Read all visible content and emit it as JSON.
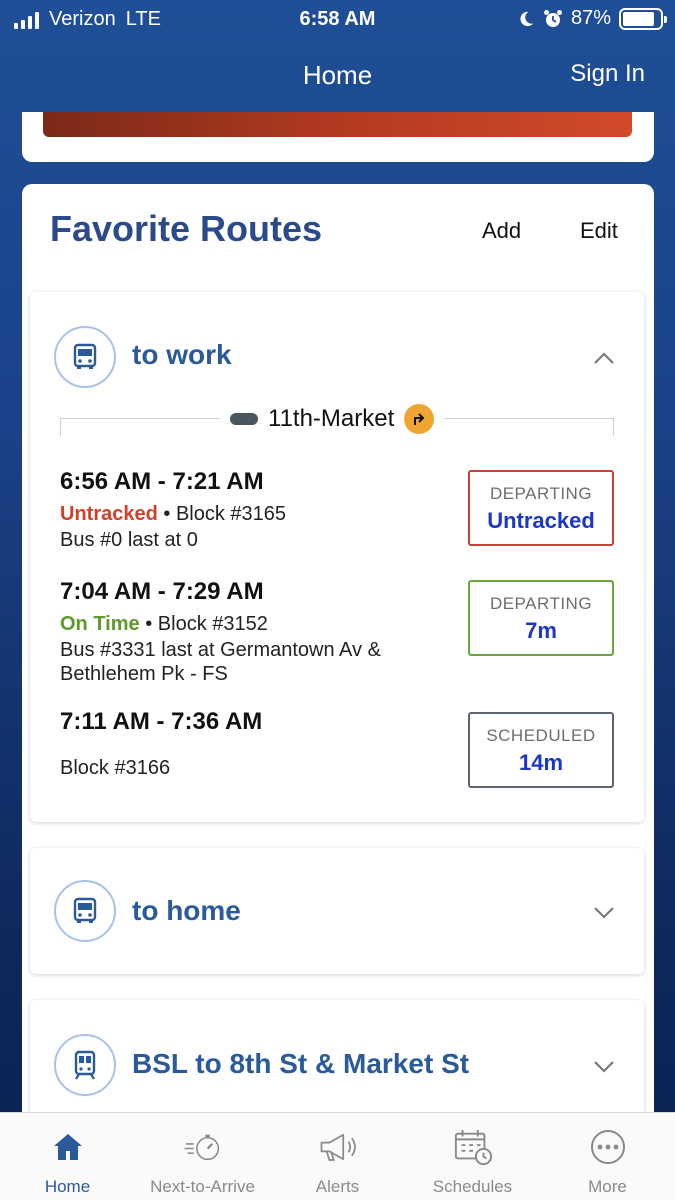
{
  "status_bar": {
    "carrier": "Verizon",
    "network": "LTE",
    "time": "6:58 AM",
    "battery": "87%",
    "battery_level": 0.87
  },
  "nav": {
    "title": "Home",
    "sign_in": "Sign In"
  },
  "favorites": {
    "title": "Favorite Routes",
    "add_label": "Add",
    "edit_label": "Edit",
    "routes": [
      {
        "name": "to work",
        "icon": "bus-icon",
        "expanded": true,
        "line": "11th-Market",
        "trips": [
          {
            "time": "6:56 AM - 7:21 AM",
            "status": "Untracked",
            "block": "Block #3165",
            "detail": "Bus #0 last at 0",
            "badge_label": "DEPARTING",
            "badge_value": "Untracked"
          },
          {
            "time": "7:04 AM - 7:29 AM",
            "status": "On Time",
            "block": "Block #3152",
            "detail": "Bus #3331 last at Germantown Av & Bethlehem Pk - FS",
            "badge_label": "DEPARTING",
            "badge_value": "7m"
          },
          {
            "time": "7:11 AM - 7:36 AM",
            "status": "",
            "block": "Block #3166",
            "detail": "",
            "badge_label": "SCHEDULED",
            "badge_value": "14m"
          }
        ]
      },
      {
        "name": "to home",
        "icon": "bus-icon",
        "expanded": false
      },
      {
        "name": "BSL to 8th St & Market St",
        "icon": "train-icon",
        "expanded": false
      }
    ]
  },
  "tabs": [
    {
      "label": "Home",
      "icon": "home-icon",
      "active": true
    },
    {
      "label": "Next-to-Arrive",
      "icon": "stopwatch-icon",
      "active": false
    },
    {
      "label": "Alerts",
      "icon": "megaphone-icon",
      "active": false
    },
    {
      "label": "Schedules",
      "icon": "calendar-icon",
      "active": false
    },
    {
      "label": "More",
      "icon": "more-icon",
      "active": false
    }
  ],
  "colors": {
    "brand_blue": "#2a4a8c",
    "status_red": "#d2402a",
    "status_green": "#5e9a2a",
    "badge_value_blue": "#1a37c8",
    "turn_orange": "#f0a431"
  }
}
